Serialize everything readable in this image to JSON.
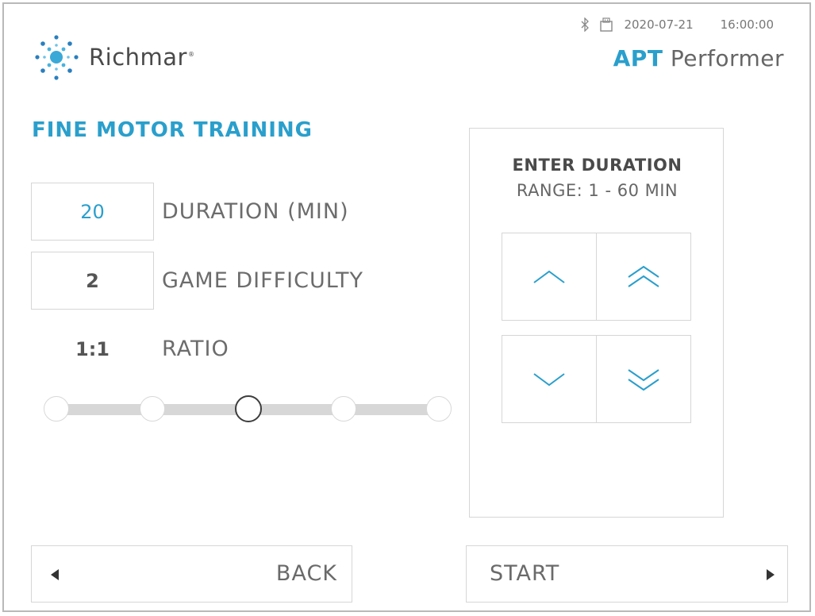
{
  "header": {
    "brand": "Richmar",
    "brand_mark": "®",
    "date": "2020-07-21",
    "time": "16:00:00",
    "product_bold": "APT",
    "product_rest": "Performer",
    "status_icons": [
      "bluetooth-icon",
      "usb-storage-icon"
    ]
  },
  "page": {
    "title": "FINE MOTOR TRAINING"
  },
  "settings": {
    "duration": {
      "value": "20",
      "label": "DURATION (MIN)"
    },
    "difficulty": {
      "value": "2",
      "label": "GAME DIFFICULTY"
    },
    "ratio": {
      "value": "1:1",
      "label": "RATIO"
    }
  },
  "ratio_slider": {
    "positions": 5,
    "selected_index": 2
  },
  "keypad": {
    "title": "ENTER DURATION",
    "range": "RANGE: 1 - 60 MIN",
    "buttons": [
      "chevron-up-icon",
      "double-chevron-up-icon",
      "chevron-down-icon",
      "double-chevron-down-icon"
    ]
  },
  "footer": {
    "back_label": "BACK",
    "start_label": "START"
  },
  "colors": {
    "accent": "#2a9fcc",
    "text": "#555555",
    "border": "#d6d6d6"
  }
}
